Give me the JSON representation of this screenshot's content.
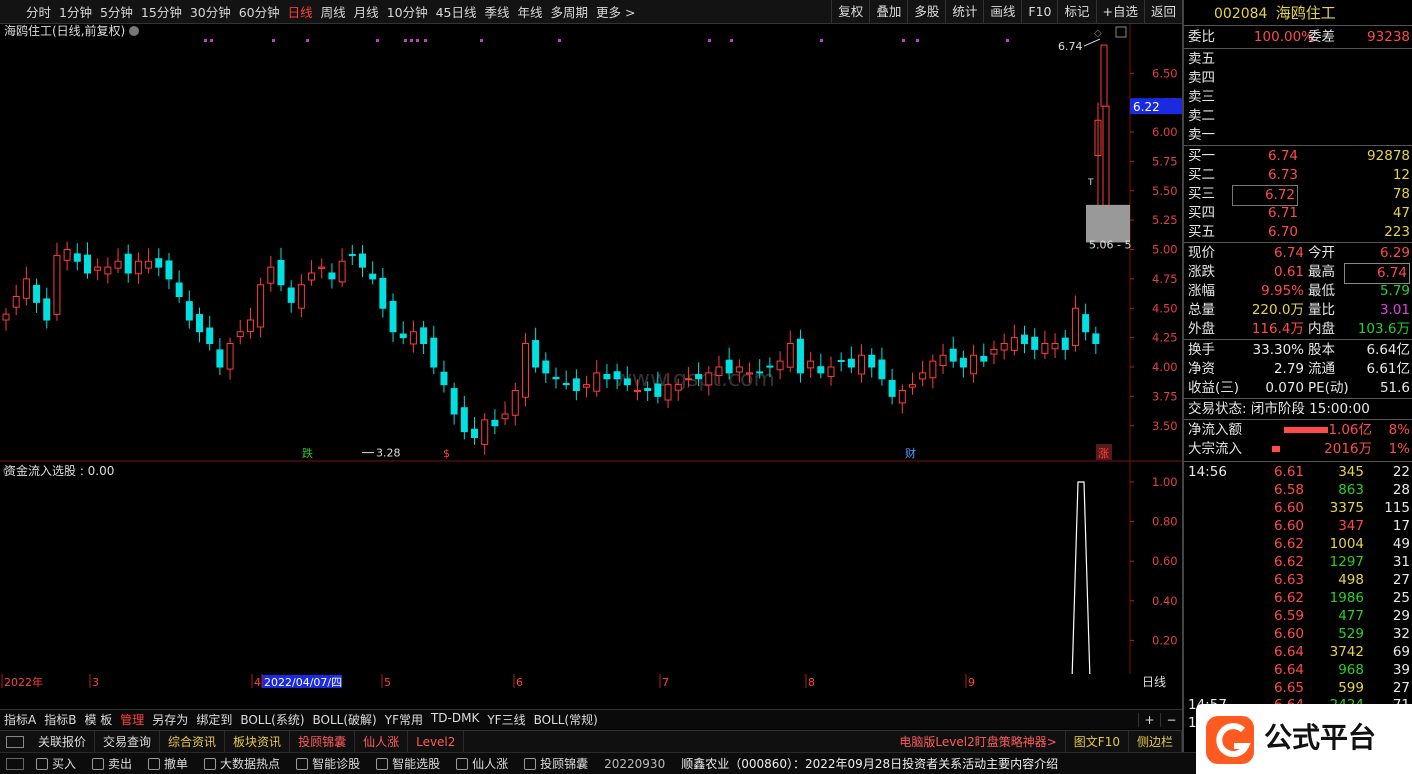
{
  "toolbar": {
    "periods": [
      "分时",
      "1分钟",
      "5分钟",
      "15分钟",
      "30分钟",
      "60分钟",
      "日线",
      "周线",
      "月线",
      "10分钟",
      "45日线",
      "季线",
      "年线",
      "多周期",
      "更多 >"
    ],
    "active_period": "日线",
    "right": [
      "复权",
      "叠加",
      "多股",
      "统计",
      "画线",
      "F10",
      "标记",
      "+自选",
      "返回"
    ]
  },
  "chart": {
    "title": "海鸥住工(日线,前复权)",
    "price_ticks": [
      "6.50",
      "6.25",
      "6.00",
      "5.75",
      "5.50",
      "5.25",
      "5.00",
      "4.75",
      "4.50",
      "4.25",
      "4.00",
      "3.75",
      "3.50"
    ],
    "current_price_tag": "6.22",
    "high_label": "6.74",
    "low_label": "3.28",
    "range_label": "5.06 - 5",
    "t_marker": "T",
    "watermark": "www.gspt.com",
    "markers": [
      "跌",
      "$",
      "财",
      "涨"
    ],
    "indicator_title": "资金流入选股 : 0.00",
    "indicator_ticks": [
      "1.00",
      "0.80",
      "0.60",
      "0.40",
      "0.20"
    ],
    "period_label": "日线",
    "x_labels": [
      "2022年",
      "3",
      "4",
      "2022/04/07/四",
      "5",
      "6",
      "7",
      "8",
      "9"
    ]
  },
  "chart_data": {
    "type": "candlestick",
    "stock": "海鸥住工",
    "ylim": [
      3.2,
      6.8
    ],
    "approx_closes": [
      4.45,
      4.6,
      4.75,
      4.55,
      4.4,
      4.95,
      5.0,
      4.9,
      4.8,
      4.85,
      4.85,
      4.9,
      4.8,
      4.9,
      4.9,
      4.85,
      4.75,
      4.6,
      4.4,
      4.3,
      4.2,
      4.0,
      4.2,
      4.3,
      4.4,
      4.7,
      4.85,
      4.7,
      4.55,
      4.7,
      4.8,
      4.85,
      4.75,
      4.9,
      4.95,
      4.85,
      4.75,
      4.5,
      4.3,
      4.25,
      4.3,
      4.2,
      4.0,
      3.85,
      3.6,
      3.45,
      3.4,
      3.55,
      3.5,
      3.6,
      3.8,
      4.2,
      4.0,
      3.95,
      3.9,
      3.85,
      3.8,
      3.85,
      3.95,
      3.9,
      3.9,
      3.85,
      3.8,
      3.8,
      3.75,
      3.85,
      3.85,
      3.9,
      3.9,
      3.95,
      4.0,
      3.95,
      4.0,
      3.95,
      3.95,
      4.0,
      4.05,
      4.2,
      3.95,
      4.05,
      3.95,
      4.0,
      4.05,
      4.0,
      4.1,
      4.0,
      3.9,
      3.75,
      3.8,
      3.85,
      3.95,
      4.05,
      4.1,
      4.05,
      4.0,
      4.1,
      4.05,
      4.15,
      4.2,
      4.25,
      4.2,
      4.15,
      4.2,
      4.2,
      4.15,
      4.5,
      4.3,
      4.2,
      6.22
    ],
    "high": 6.74,
    "low": 3.28,
    "indicator_spike": 1.0
  },
  "right_panel": {
    "code": "002084",
    "name": "海鸥住工",
    "weibi_label": "委比",
    "weibi": "100.00%",
    "weicha_label": "委差",
    "weicha": "93238",
    "sells": [
      {
        "label": "卖五"
      },
      {
        "label": "卖四"
      },
      {
        "label": "卖三"
      },
      {
        "label": "卖二"
      },
      {
        "label": "卖一"
      }
    ],
    "buys": [
      {
        "label": "买一",
        "price": "6.74",
        "vol": "92878"
      },
      {
        "label": "买二",
        "price": "6.73",
        "vol": "12"
      },
      {
        "label": "买三",
        "price": "6.72",
        "vol": "78"
      },
      {
        "label": "买四",
        "price": "6.71",
        "vol": "47"
      },
      {
        "label": "买五",
        "price": "6.70",
        "vol": "223"
      }
    ],
    "stats": [
      {
        "l1": "现价",
        "v1": "6.74",
        "c1": "r",
        "l2": "今开",
        "v2": "6.29",
        "c2": "r"
      },
      {
        "l1": "涨跌",
        "v1": "0.61",
        "c1": "r",
        "l2": "最高",
        "v2": "6.74",
        "c2": "r"
      },
      {
        "l1": "涨幅",
        "v1": "9.95%",
        "c1": "r",
        "l2": "最低",
        "v2": "5.79",
        "c2": "g"
      },
      {
        "l1": "总量",
        "v1": "220.0万",
        "c1": "y",
        "l2": "量比",
        "v2": "3.01",
        "c2": "m"
      },
      {
        "l1": "外盘",
        "v1": "116.4万",
        "c1": "r",
        "l2": "内盘",
        "v2": "103.6万",
        "c2": "g"
      }
    ],
    "stats2": [
      {
        "l1": "换手",
        "v1": "33.30%",
        "l2": "股本",
        "v2": "6.64亿"
      },
      {
        "l1": "净资",
        "v1": "2.79",
        "l2": "流通",
        "v2": "6.61亿"
      },
      {
        "l1": "收益(三)",
        "v1": "0.070",
        "l2": "PE(动)",
        "v2": "51.6"
      }
    ],
    "trade_status_label": "交易状态:",
    "trade_status": "闭市阶段 15:00:00",
    "inflow": [
      {
        "label": "净流入额",
        "value": "1.06亿",
        "pct": "8%"
      },
      {
        "label": "大宗流入",
        "value": "2016万",
        "pct": "1%"
      }
    ],
    "ticks_time": "14:56",
    "ticks": [
      [
        "6.61",
        "345",
        "22"
      ],
      [
        "6.58",
        "863",
        "28"
      ],
      [
        "6.60",
        "3375",
        "115"
      ],
      [
        "6.60",
        "347",
        "17"
      ],
      [
        "6.62",
        "1004",
        "49"
      ],
      [
        "6.62",
        "1297",
        "31"
      ],
      [
        "6.63",
        "498",
        "27"
      ],
      [
        "6.62",
        "1986",
        "25"
      ],
      [
        "6.59",
        "477",
        "29"
      ],
      [
        "6.60",
        "529",
        "32"
      ],
      [
        "6.64",
        "3742",
        "69"
      ],
      [
        "6.64",
        "968",
        "39"
      ],
      [
        "6.65",
        "599",
        "27"
      ]
    ],
    "ticks_time2": "14:57",
    "tick_last": [
      "6.64",
      "2424",
      "71"
    ],
    "time3": "15"
  },
  "index_bar": {
    "items": [
      "指标A",
      "指标B",
      "模 板",
      "管理",
      "另存为",
      "绑定到",
      "BOLL(系统)",
      "BOLL(破解)",
      "YF常用",
      "TD-DMK",
      "YF三线",
      "BOLL(常规)"
    ],
    "selected": "管理",
    "plus": "+",
    "minus": "−"
  },
  "tab_bar": {
    "tabs": [
      "关联报价",
      "交易查询",
      "综合资讯",
      "板块资讯",
      "投顾锦囊",
      "仙人涨",
      "Level2"
    ],
    "right": [
      "电脑版Level2盯盘策略神器>",
      "图文F10",
      "侧边栏"
    ]
  },
  "status_bar": {
    "items": [
      "买入",
      "卖出",
      "撤单",
      "大数据热点",
      "智能诊股",
      "智能选股",
      "仙人涨",
      "投顾锦囊"
    ],
    "date": "20220930",
    "news": "顺鑫农业（000860）：2022年09月28日投资者关系活动主要内容介绍"
  },
  "logo": {
    "text": "公式平台"
  }
}
